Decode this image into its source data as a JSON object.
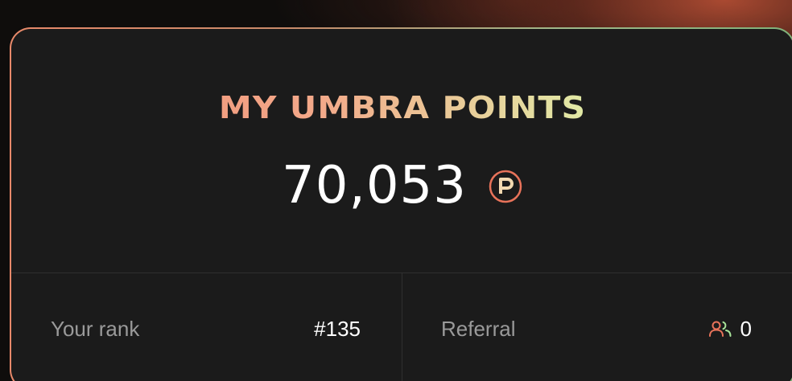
{
  "card": {
    "title": "MY UMBRA POINTS",
    "points": "70,053",
    "points_icon": "points-coin-icon",
    "accent_gradient": [
      "#f0846a",
      "#f3a98a",
      "#dff0a8",
      "#b7ec9f"
    ]
  },
  "stats": {
    "rank_label": "Your rank",
    "rank_value": "#135",
    "referral_label": "Referral",
    "referral_value": "0",
    "referral_icon": "users-icon"
  },
  "colors": {
    "card_bg": "#1b1b1b",
    "label_gray": "#9a9a9a",
    "value_white": "#ffffff",
    "icon_orange": "#e8735a",
    "icon_green": "#a8e49a"
  }
}
